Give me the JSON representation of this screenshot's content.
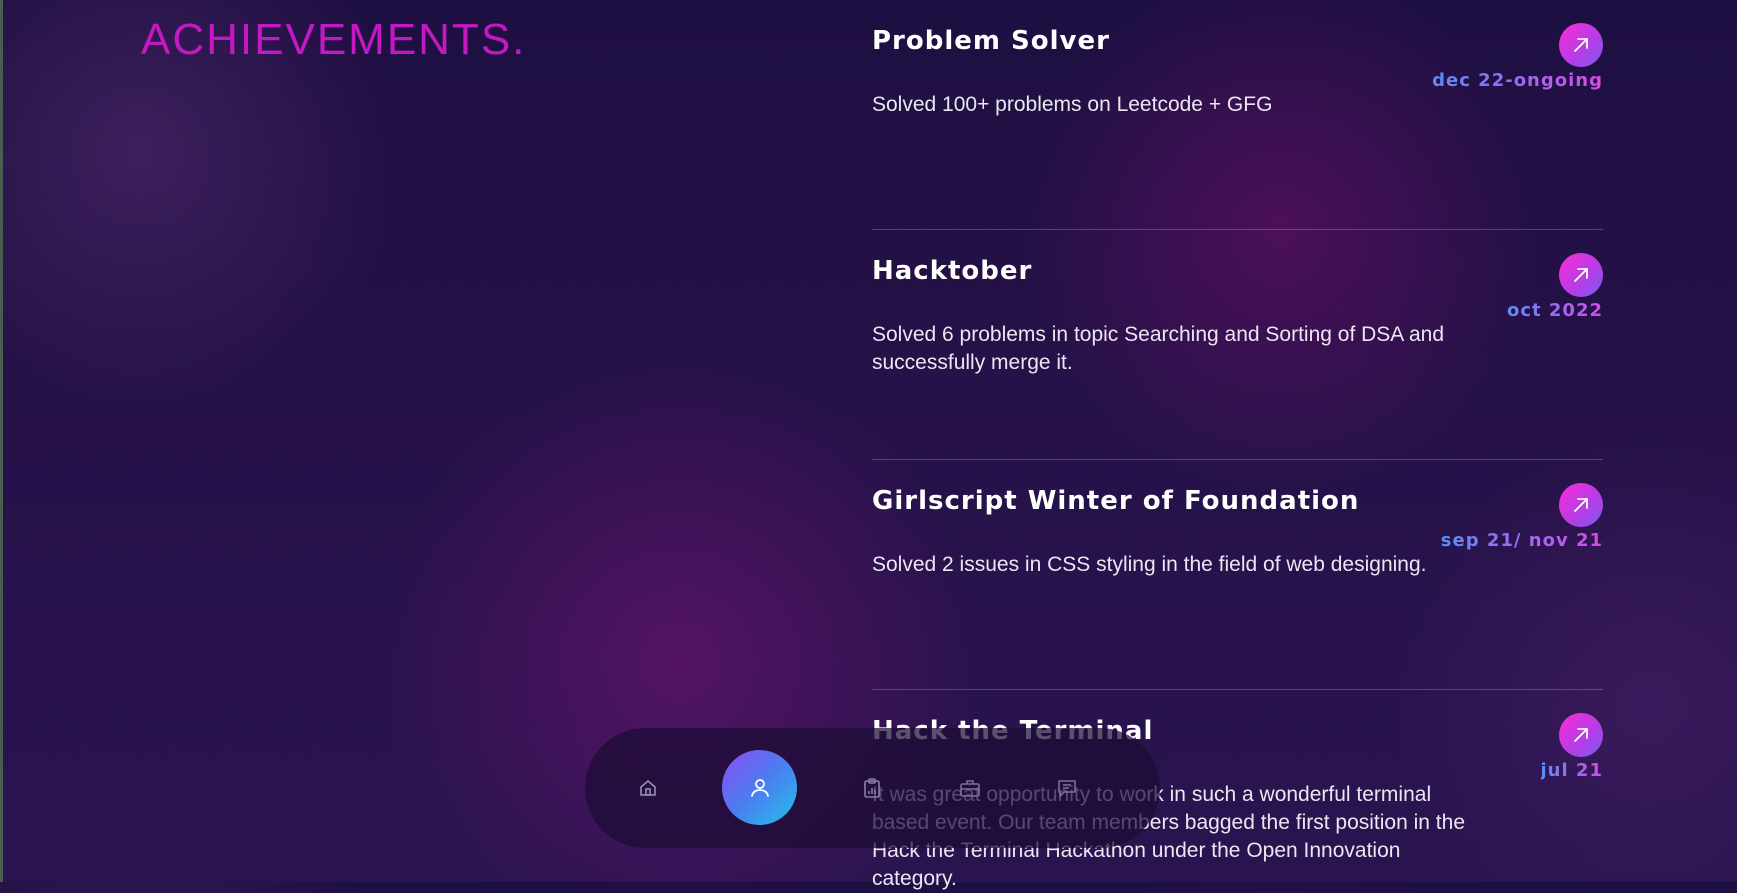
{
  "section": {
    "title": "ACHIEVEMENTS."
  },
  "achievements": [
    {
      "title": "Problem Solver",
      "date": "dec 22-ongoing",
      "description": "Solved 100+ problems on Leetcode + GFG",
      "icon": "arrow-up-right-icon"
    },
    {
      "title": "Hacktober",
      "date": "oct 2022",
      "description": "Solved 6 problems in topic Searching and Sorting of DSA and successfully merge it.",
      "icon": "arrow-up-right-icon"
    },
    {
      "title": "Girlscript Winter of Foundation",
      "date": "sep 21/ nov 21",
      "description": "Solved 2 issues in CSS styling in the field of web designing.",
      "icon": "arrow-up-right-icon"
    },
    {
      "title": "Hack the Terminal",
      "date": "jul 21",
      "description": "It was great opportunity to work in such a wonderful terminal based event. Our team members bagged the first position in the Hack the Terminal Hackathon under the Open Innovation category.",
      "icon": "arrow-up-right-icon"
    }
  ],
  "nav": {
    "items": [
      {
        "icon": "home-icon",
        "active": false
      },
      {
        "icon": "user-icon",
        "active": true
      },
      {
        "icon": "clipboard-icon",
        "active": false
      },
      {
        "icon": "briefcase-icon",
        "active": false
      },
      {
        "icon": "message-icon",
        "active": false
      }
    ]
  },
  "colors": {
    "accent": "#c318c2",
    "background": "#221047",
    "arrow_gradient_start": "#ff2bd6",
    "arrow_gradient_end": "#7b5cf5",
    "date_gradient_start": "#5b8df5",
    "date_gradient_end": "#d84ae8",
    "nav_active_start": "#8c4ef2",
    "nav_active_end": "#23c2e8"
  }
}
